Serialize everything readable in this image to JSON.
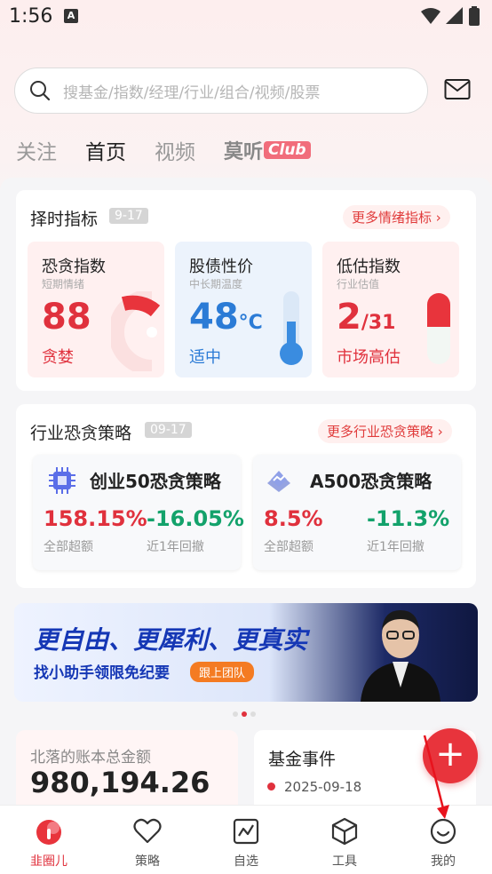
{
  "status_bar": {
    "time": "1:56",
    "notif_letter": "A"
  },
  "search": {
    "placeholder": "搜基金/指数/经理/行业/组合/视频/股票"
  },
  "tabs": [
    "关注",
    "首页",
    "视频"
  ],
  "club": {
    "text": "莫听",
    "badge": "Club"
  },
  "timing": {
    "title": "择时指标",
    "date": "9-17",
    "more": "更多情绪指标",
    "cards": [
      {
        "title": "恐贪指数",
        "sub": "短期情绪",
        "value": "88",
        "unit": "",
        "desc": "贪婪"
      },
      {
        "title": "股债性价",
        "sub": "中长期温度",
        "value": "48",
        "unit": "°C",
        "desc": "适中"
      },
      {
        "title": "低估指数",
        "sub": "行业估值",
        "value": "2",
        "unit": "/31",
        "desc": "市场高估"
      }
    ]
  },
  "strategy": {
    "title": "行业恐贪策略",
    "date": "09-17",
    "more": "更多行业恐贪策略",
    "items": [
      {
        "name": "创业50恐贪策略",
        "v1": "158.15%",
        "l1": "全部超额",
        "v2": "-16.05%",
        "l2": "近1年回撤"
      },
      {
        "name": "A500恐贪策略",
        "v1": "8.5%",
        "l1": "全部超额",
        "v2": "-11.3%",
        "l2": "近1年回撤"
      }
    ]
  },
  "banner": {
    "title": "更自由、更犀利、更真实",
    "sub": "找小助手领限免纪要",
    "button": "跟上团队"
  },
  "assets": {
    "label": "北落的账本总金额",
    "value": "980,194.26"
  },
  "events": {
    "title": "基金事件",
    "date": "2025-09-18"
  },
  "fab": {
    "symbol": "+"
  },
  "nav": [
    "韭圈儿",
    "策略",
    "自选",
    "工具",
    "我的"
  ],
  "colors": {
    "accent": "#e0313d",
    "blue": "#2b7bd6",
    "green": "#13a26b"
  }
}
